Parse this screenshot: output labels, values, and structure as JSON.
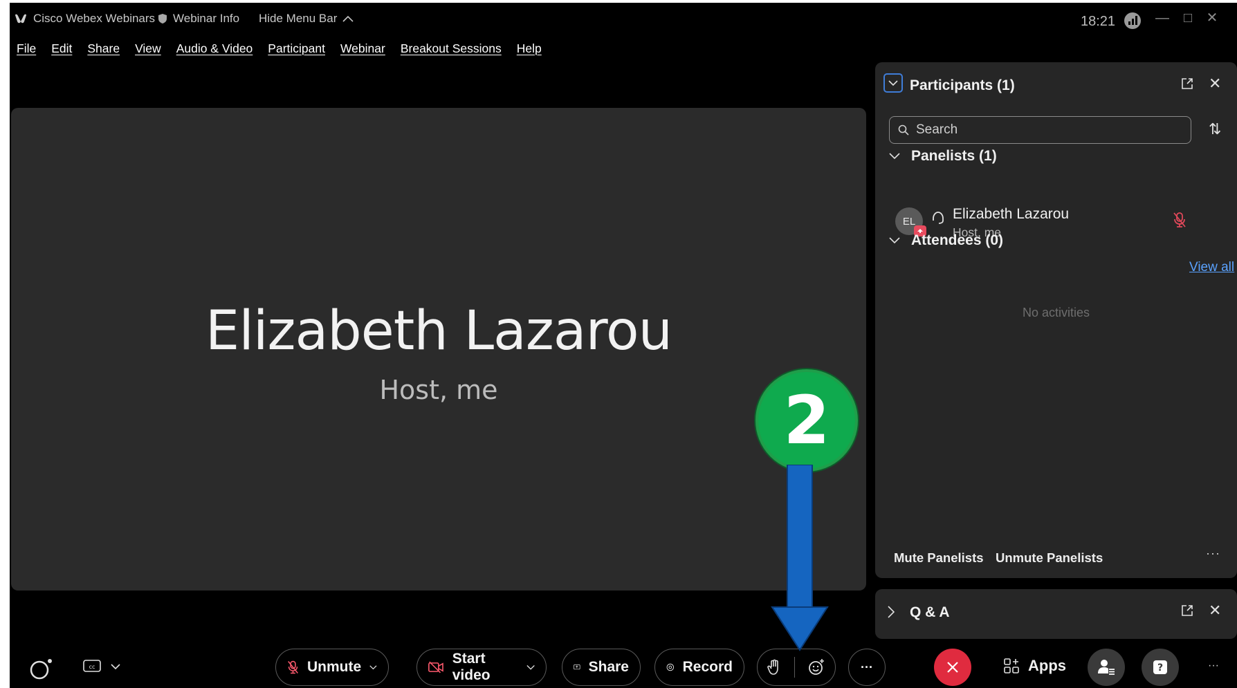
{
  "titlebar": {
    "app_name": "Cisco Webex Webinars",
    "webinar_info": "Webinar Info",
    "hide_menu_bar": "Hide Menu Bar",
    "clock": "18:21"
  },
  "menu": [
    "File",
    "Edit",
    "Share",
    "View",
    "Audio & Video",
    "Participant",
    "Webinar",
    "Breakout Sessions",
    "Help"
  ],
  "stage": {
    "name": "Elizabeth Lazarou",
    "role": "Host, me"
  },
  "participants_panel": {
    "title": "Participants (1)",
    "search_placeholder": "Search",
    "panelists_header": "Panelists (1)",
    "panelist": {
      "initials": "EL",
      "name": "Elizabeth Lazarou",
      "role": "Host, me"
    },
    "attendees_header": "Attendees (0)",
    "view_all": "View all",
    "no_activities": "No activities",
    "mute_panelists": "Mute Panelists",
    "unmute_panelists": "Unmute Panelists",
    "more": "···"
  },
  "qa_panel": {
    "title": "Q & A"
  },
  "controls": {
    "unmute": "Unmute",
    "start_video": "Start video",
    "share": "Share",
    "record": "Record",
    "more": "···",
    "apps": "Apps",
    "overflow": "···"
  },
  "annotation": {
    "step_number": "2",
    "colors": {
      "badge": "#0faa4e",
      "arrow": "#1565c0"
    }
  },
  "colors": {
    "accent_blue": "#5aa2ff",
    "end_call_red": "#e02b3f",
    "panel_bg": "#262626",
    "stage_bg": "#2b2b2b"
  }
}
